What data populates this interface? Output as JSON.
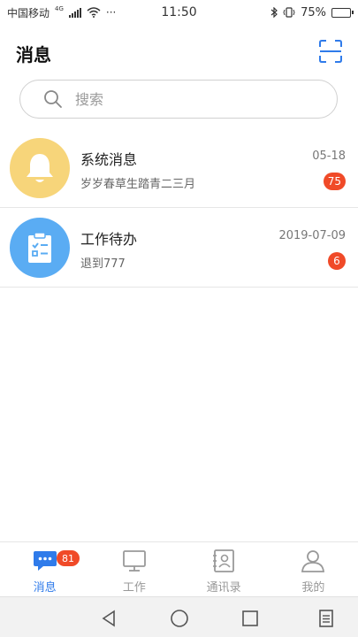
{
  "status_bar": {
    "carrier": "中国移动",
    "network": "4G",
    "dots": "···",
    "time": "11:50",
    "battery": "75%",
    "battery_level": 0.75
  },
  "header": {
    "title": "消息",
    "scan_icon": "scan-icon"
  },
  "search": {
    "placeholder": "搜索",
    "value": ""
  },
  "messages": [
    {
      "title": "系统消息",
      "subtitle": "岁岁春草生踏青二三月",
      "date": "05-18",
      "badge": "75",
      "icon": "bell-icon",
      "color": "#f7d57a"
    },
    {
      "title": "工作待办",
      "subtitle": "退到777",
      "date": "2019-07-09",
      "badge": "6",
      "icon": "clipboard-icon",
      "color": "#5aacf3"
    }
  ],
  "tabbar": {
    "tabs": [
      {
        "label": "消息",
        "icon": "chat-icon",
        "badge": "81",
        "active": true
      },
      {
        "label": "工作",
        "icon": "monitor-icon",
        "active": false
      },
      {
        "label": "通讯录",
        "icon": "contacts-icon",
        "active": false
      },
      {
        "label": "我的",
        "icon": "person-icon",
        "active": false
      }
    ]
  },
  "colors": {
    "accent": "#2f7bea",
    "badge": "#f04a28",
    "divider": "#e6e6e6"
  }
}
